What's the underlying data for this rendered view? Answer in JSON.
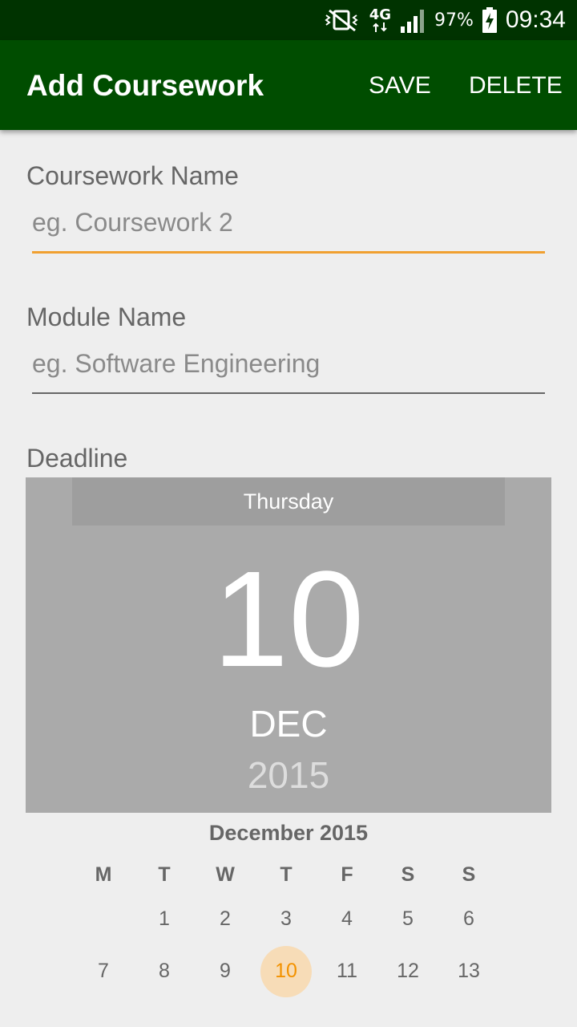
{
  "status_bar": {
    "network_label": "4G",
    "battery_pct": "97%",
    "time": "09:34",
    "icons": [
      "vibrate-mute-icon",
      "network-4g-icon",
      "signal-icon",
      "battery-charging-icon"
    ]
  },
  "app_bar": {
    "title": "Add Coursework",
    "save_label": "SAVE",
    "delete_label": "DELETE",
    "background": "#004d00",
    "status_background": "#003300"
  },
  "form": {
    "coursework": {
      "label": "Coursework Name",
      "placeholder": "eg. Coursework 2",
      "value": ""
    },
    "module": {
      "label": "Module Name",
      "placeholder": "eg. Software Engineering",
      "value": ""
    },
    "deadline_label": "Deadline",
    "focus_color": "#f0a030"
  },
  "date_picker": {
    "weekday": "Thursday",
    "day": "10",
    "month": "DEC",
    "year": "2015",
    "calendar_title": "December 2015",
    "days_of_week": [
      "M",
      "T",
      "W",
      "T",
      "F",
      "S",
      "S"
    ],
    "weeks": [
      [
        "",
        "1",
        "2",
        "3",
        "4",
        "5",
        "6"
      ],
      [
        "7",
        "8",
        "9",
        "10",
        "11",
        "12",
        "13"
      ]
    ],
    "selected_day": "10",
    "accent": "#f39200"
  }
}
